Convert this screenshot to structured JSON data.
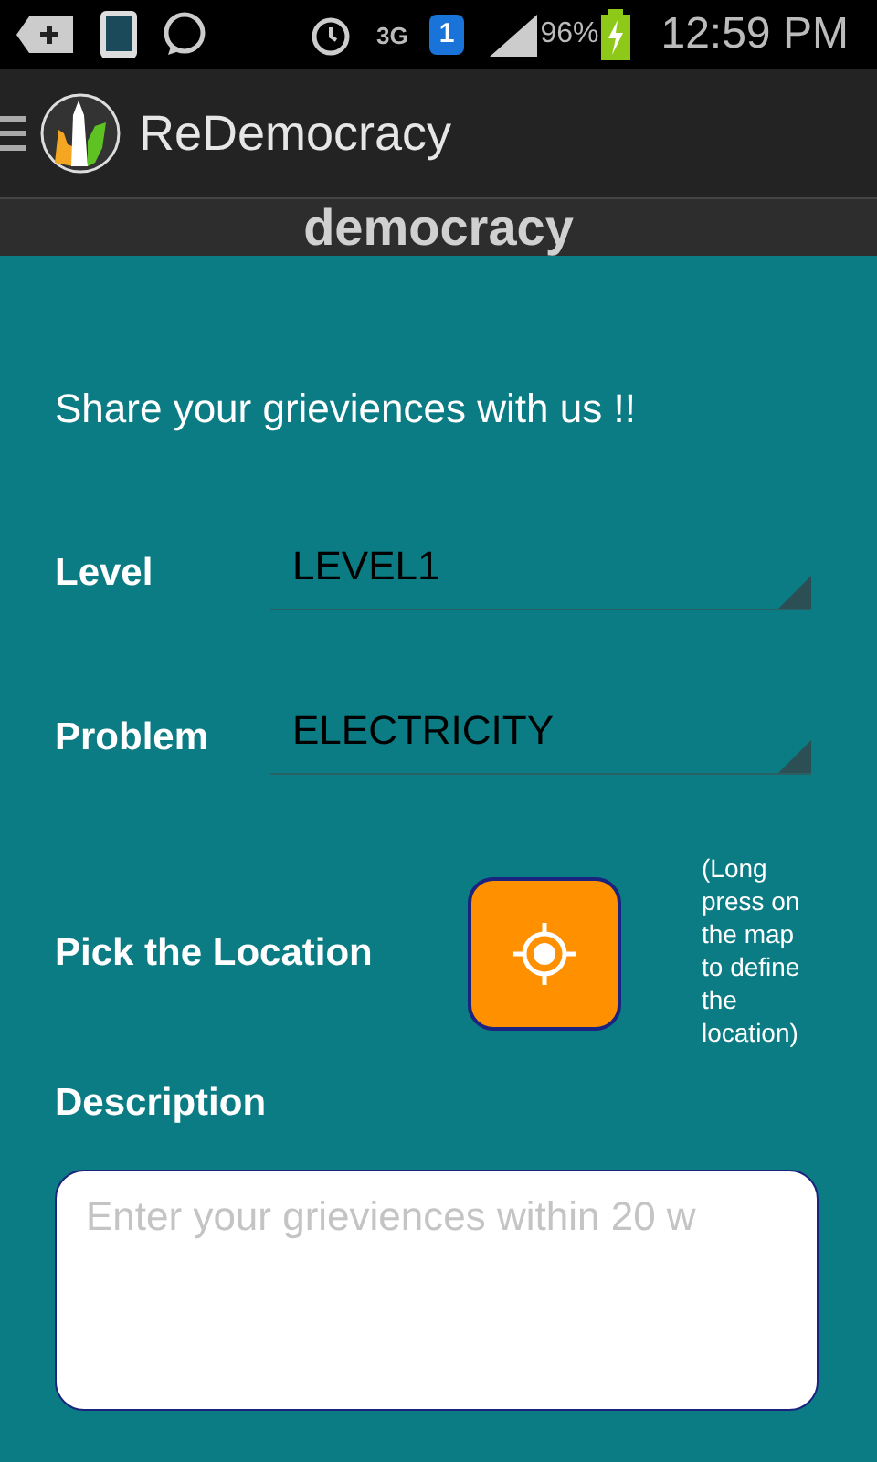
{
  "status_bar": {
    "battery_percent": "96%",
    "time": "12:59 PM",
    "network": "3G",
    "sim": "1"
  },
  "action_bar": {
    "title": "ReDemocracy"
  },
  "banner": {
    "text": "democracy"
  },
  "form": {
    "intro": "Share your grieviences with us !!",
    "spinners": [
      {
        "label": "Level",
        "value": "LEVEL1"
      },
      {
        "label": "Problem",
        "value": "ELECTRICITY"
      }
    ],
    "location": {
      "label": "Pick the Location",
      "hint": "(Long press on the map to define the location)"
    },
    "description": {
      "label": "Description",
      "placeholder": "Enter your grieviences within 20 w"
    }
  }
}
